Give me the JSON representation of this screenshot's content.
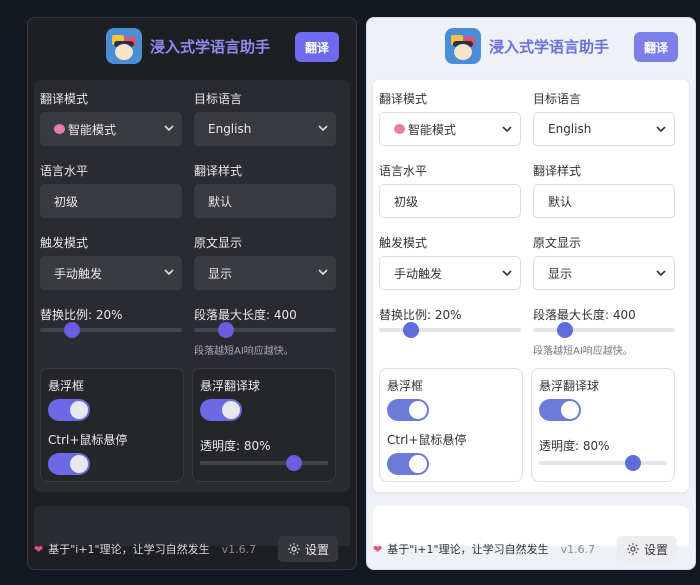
{
  "header": {
    "title": "浸入式学语言助手",
    "translate_button": "翻译"
  },
  "fields": {
    "translate_mode": {
      "label": "翻译模式",
      "value": "智能模式"
    },
    "target_language": {
      "label": "目标语言",
      "value": "English"
    },
    "language_level": {
      "label": "语言水平",
      "value": "初级"
    },
    "translate_style": {
      "label": "翻译样式",
      "value": "默认"
    },
    "trigger_mode": {
      "label": "触发模式",
      "value": "手动触发"
    },
    "original_display": {
      "label": "原文显示",
      "value": "显示"
    }
  },
  "sliders": {
    "replace_ratio": {
      "label": "替换比例: 20%",
      "value": 0.2
    },
    "paragraph_max": {
      "label": "段落最大长度: 400",
      "value": 0.2,
      "hint": "段落越短AI响应越快。"
    }
  },
  "floating_box": {
    "title": "悬浮框",
    "enabled": true,
    "hover_label": "Ctrl+鼠标悬停",
    "hover_enabled": true
  },
  "floating_ball": {
    "title": "悬浮翻译球",
    "enabled": true,
    "opacity_label": "透明度: 80%",
    "opacity": 0.8
  },
  "footer": {
    "slogan": "基于\"i+1\"理论，让学习自然发生",
    "version": "v1.6.7",
    "settings_button": "设置"
  },
  "colors": {
    "accent": "#6a6ae6",
    "dark_bg": "#1e1f23",
    "light_bg": "#eef1f6"
  }
}
